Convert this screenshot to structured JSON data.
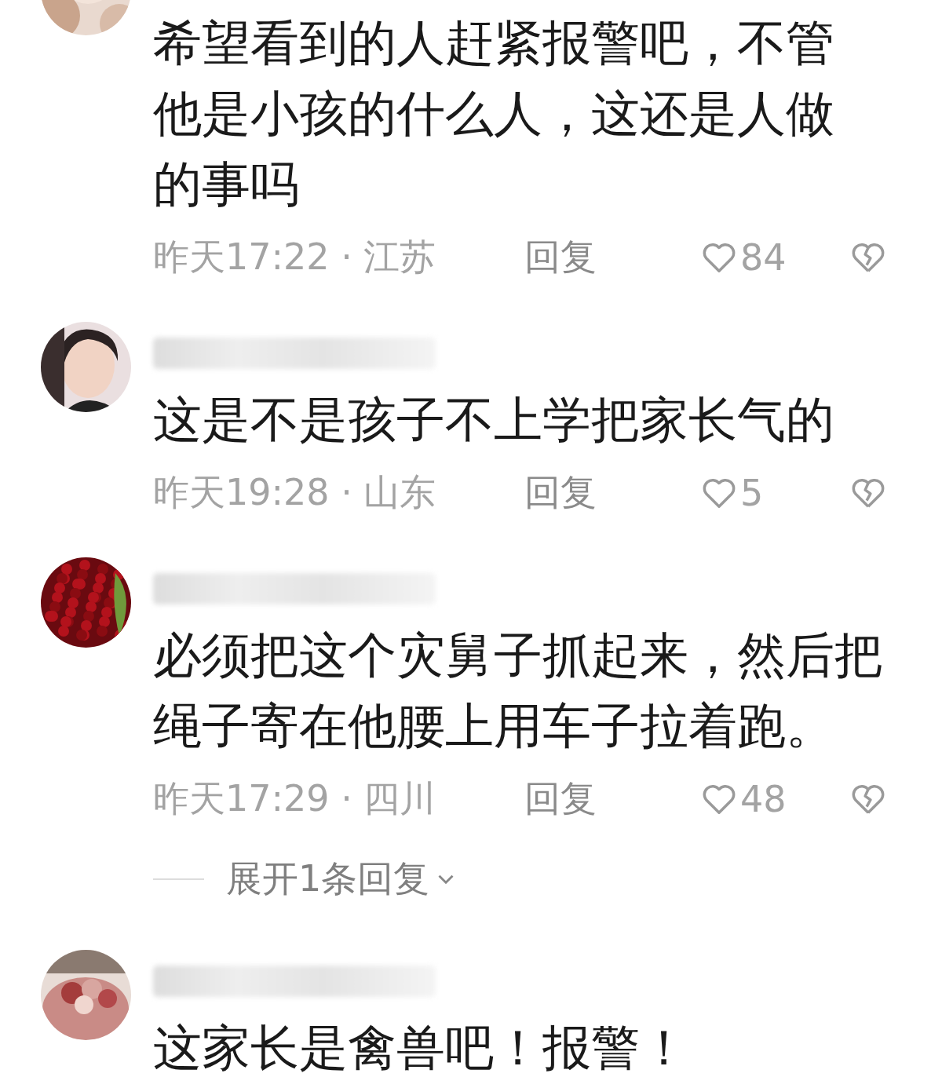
{
  "comments": [
    {
      "avatar": {
        "kind": "picture"
      },
      "text_lines": [
        "希望看到的人赶紧报警吧，不管",
        "他是小孩的什么人，这还是人做",
        "的事吗"
      ],
      "time": "昨天17:22 · 江苏",
      "reply": "回复",
      "likes": "84"
    },
    {
      "avatar": {
        "kind": "picture"
      },
      "name_blurred": true,
      "text_lines": [
        "这是不是孩子不上学把家长气的"
      ],
      "time": "昨天19:28 · 山东",
      "reply": "回复",
      "likes": "5"
    },
    {
      "avatar": {
        "kind": "picture"
      },
      "name_blurred": true,
      "text_lines": [
        "必须把这个灾舅子抓起来，然后把",
        "绳子寄在他腰上用车子拉着跑。"
      ],
      "time": "昨天17:29 · 四川",
      "reply": "回复",
      "likes": "48",
      "expand": "展开1条回复"
    },
    {
      "avatar": {
        "kind": "picture"
      },
      "name_blurred": true,
      "text_lines": [
        "这家长是禽兽吧！报警！"
      ]
    }
  ]
}
